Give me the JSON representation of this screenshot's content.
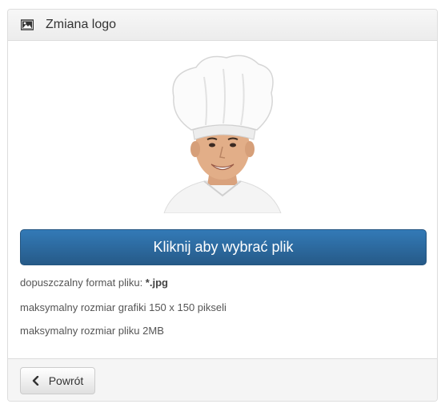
{
  "panel": {
    "title": "Zmiana logo",
    "title_icon": "picture-icon"
  },
  "photo": {
    "description_icon": "chef-photo"
  },
  "upload": {
    "button_label": "Kliknij aby wybrać plik"
  },
  "info": {
    "format_label": "dopuszczalny format pliku: ",
    "format_value": "*.jpg",
    "max_image_size": "maksymalny rozmiar grafiki 150 x 150 pikseli",
    "max_file_size": "maksymalny rozmiar pliku 2MB"
  },
  "footer": {
    "back_label": "Powrót",
    "back_icon": "chevron-left-icon"
  },
  "colors": {
    "primary": "#337ab7",
    "header_bg": "#f5f5f5",
    "border": "#dddddd"
  }
}
